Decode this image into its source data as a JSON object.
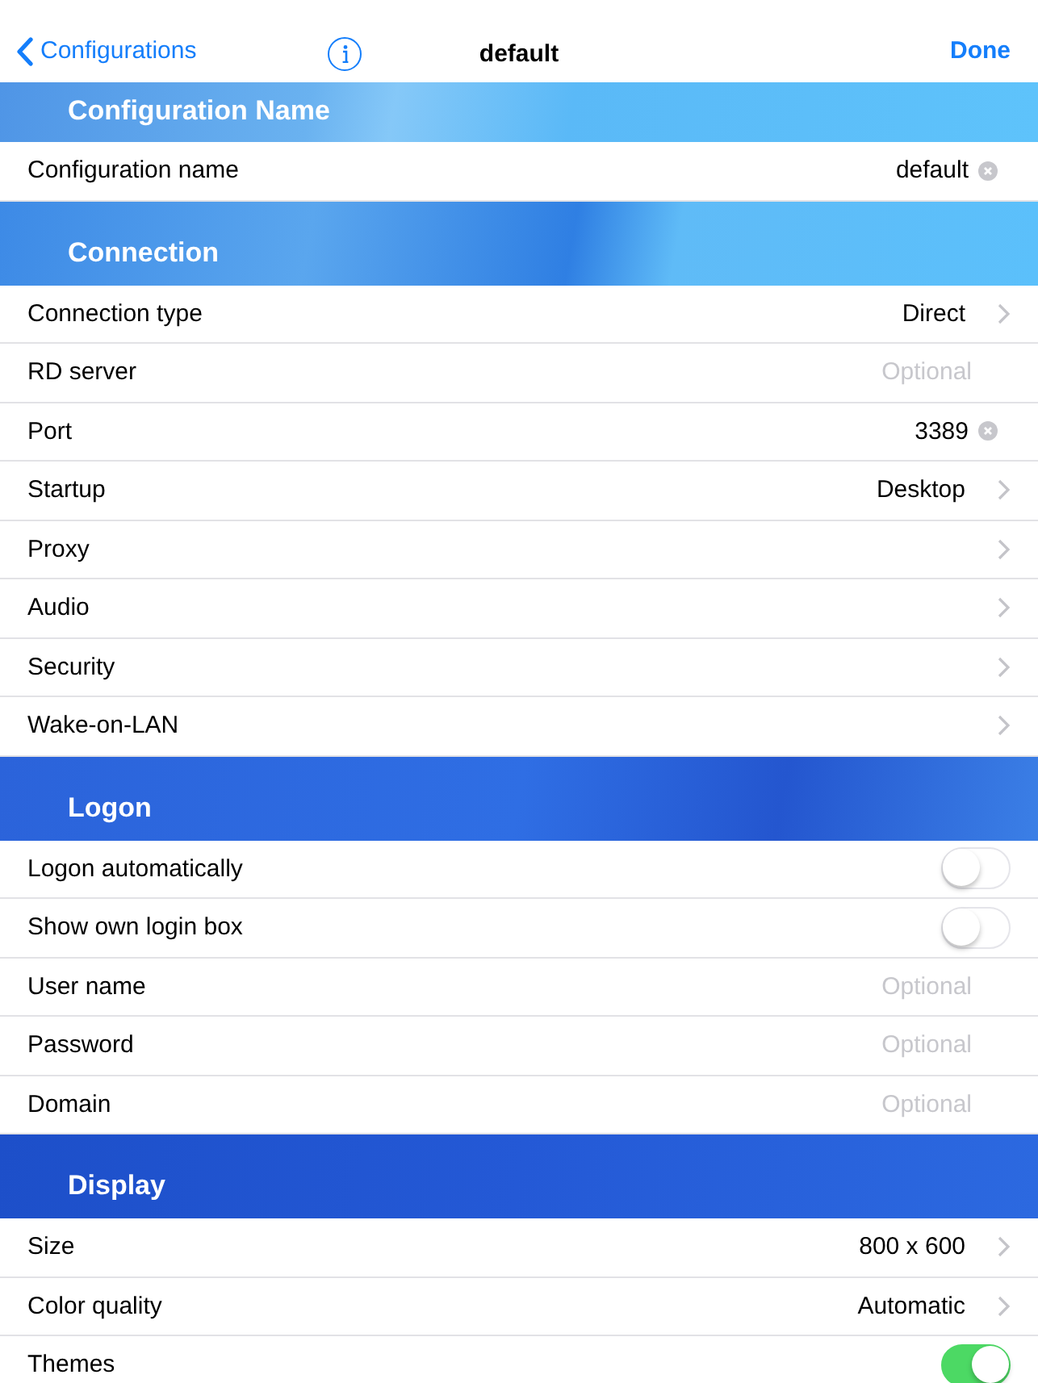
{
  "nav": {
    "back": "Configurations",
    "title": "default",
    "done": "Done"
  },
  "sections": [
    {
      "title": "Configuration Name",
      "rows": [
        {
          "kind": "text",
          "label": "Configuration name",
          "value": "default"
        }
      ]
    },
    {
      "title": "Connection",
      "rows": [
        {
          "kind": "link",
          "label": "Connection type",
          "value": "Direct"
        },
        {
          "kind": "input",
          "label": "RD server",
          "placeholder": "Optional"
        },
        {
          "kind": "text",
          "label": "Port",
          "value": "3389"
        },
        {
          "kind": "link",
          "label": "Startup",
          "value": "Desktop"
        },
        {
          "kind": "link",
          "label": "Proxy"
        },
        {
          "kind": "link",
          "label": "Audio"
        },
        {
          "kind": "link",
          "label": "Security"
        },
        {
          "kind": "link",
          "label": "Wake-on-LAN"
        }
      ]
    },
    {
      "title": "Logon",
      "rows": [
        {
          "kind": "toggle",
          "label": "Logon automatically",
          "on": false
        },
        {
          "kind": "toggle",
          "label": "Show own login box",
          "on": false
        },
        {
          "kind": "input",
          "label": "User name",
          "placeholder": "Optional"
        },
        {
          "kind": "input",
          "label": "Password",
          "placeholder": "Optional"
        },
        {
          "kind": "input",
          "label": "Domain",
          "placeholder": "Optional"
        }
      ]
    },
    {
      "title": "Display",
      "rows": [
        {
          "kind": "link",
          "label": "Size",
          "value": "800 x 600"
        },
        {
          "kind": "link",
          "label": "Color quality",
          "value": "Automatic"
        },
        {
          "kind": "toggle",
          "label": "Themes",
          "on": true
        }
      ]
    }
  ]
}
